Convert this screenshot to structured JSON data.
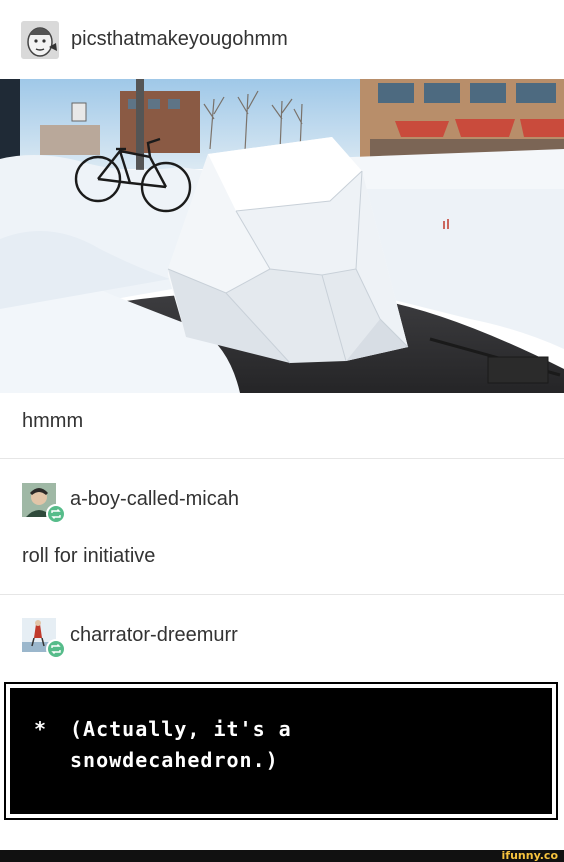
{
  "post": {
    "author": "picsthatmakeyougohmm",
    "caption": "hmmm"
  },
  "reblogs": [
    {
      "username": "a-boy-called-micah",
      "text": "roll for initiative"
    },
    {
      "username": "charrator-dreemurr"
    }
  ],
  "dialog": {
    "star": "*",
    "text": "(Actually, it's a\nsnowdecahedron.)"
  },
  "watermark": "ifunny.co",
  "colors": {
    "reblog_badge": "#56bc8a",
    "dialog_bg": "#000000",
    "watermark": "#f6c33e"
  }
}
